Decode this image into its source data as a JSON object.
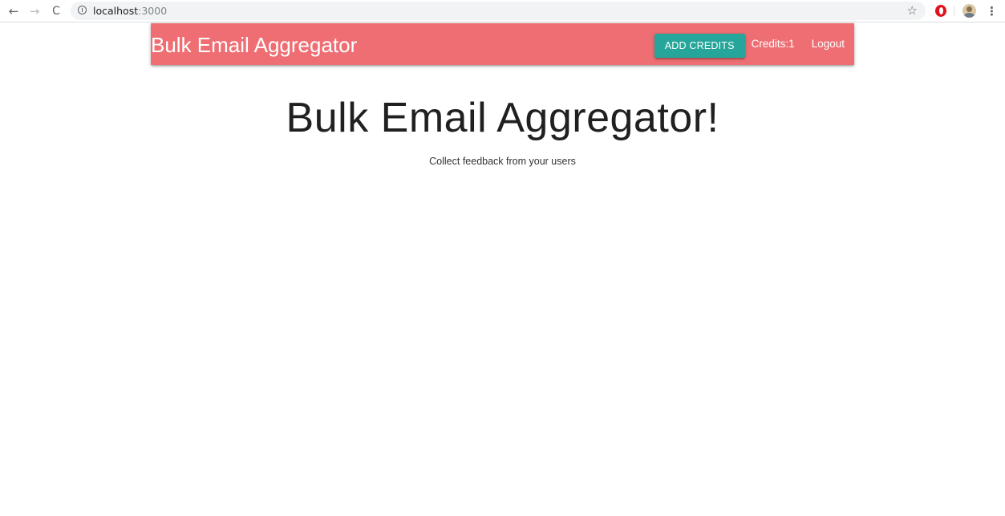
{
  "browser": {
    "url_host": "localhost",
    "url_port": ":3000",
    "back_glyph": "←",
    "forward_glyph": "→",
    "reload_glyph": "C",
    "star_glyph": "☆",
    "menu_glyph": "⋮",
    "icons": [
      "back-arrow-icon",
      "forward-arrow-icon",
      "reload-icon",
      "info-icon",
      "star-icon",
      "opera-icon",
      "profile-avatar",
      "menu-icon"
    ]
  },
  "navbar": {
    "brand": "Bulk Email Aggregator",
    "add_credits_label": "ADD CREDITS",
    "credits_label": "Credits:1",
    "logout_label": "Logout",
    "background_color": "#ee6e73",
    "button_color": "#26a69a"
  },
  "main": {
    "title": "Bulk Email Aggregator!",
    "subtitle": "Collect feedback from your users"
  }
}
